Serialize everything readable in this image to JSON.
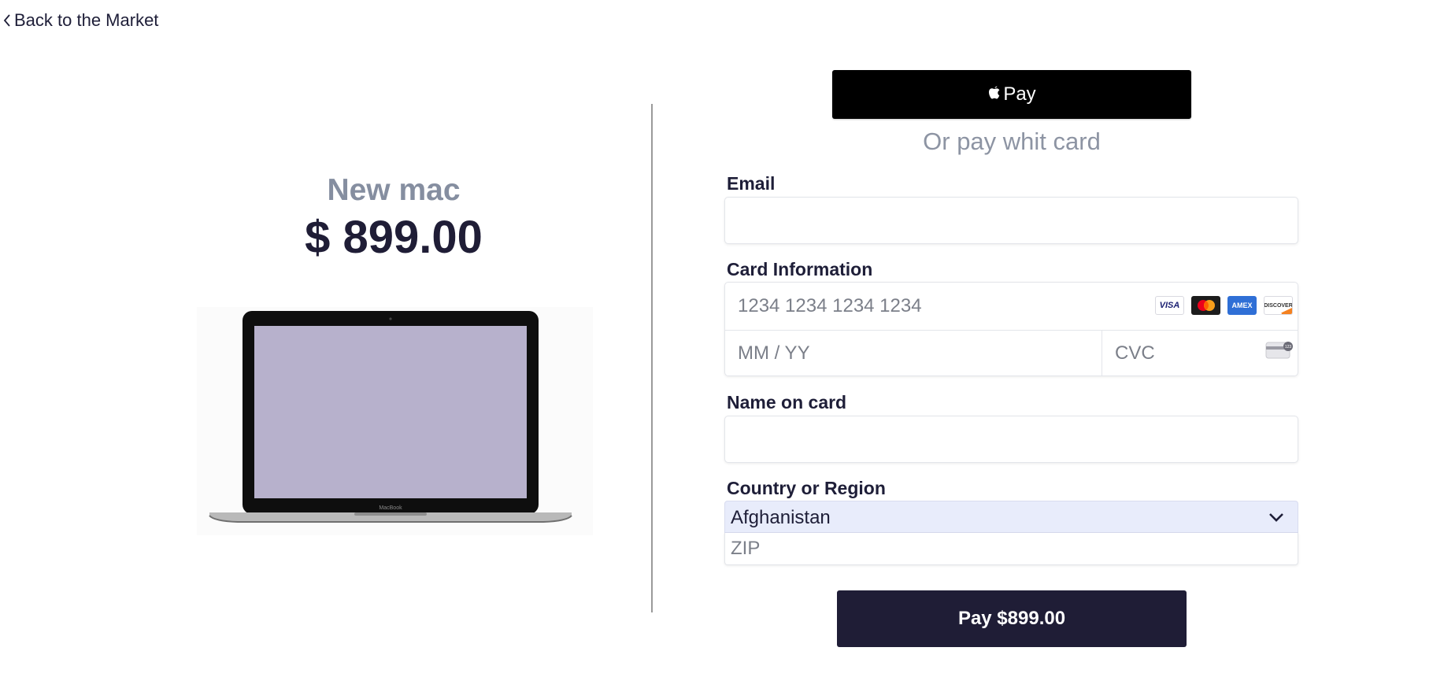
{
  "nav": {
    "back_label": "Back to the Market"
  },
  "product": {
    "name": "New mac",
    "price": "$ 899.00",
    "image_alt": "MacBook laptop",
    "laptop_brand": "MacBook"
  },
  "apple_pay": {
    "label": "Pay"
  },
  "divider_text": "Or pay whit card",
  "form": {
    "email": {
      "label": "Email",
      "value": "",
      "placeholder": ""
    },
    "card": {
      "label": "Card Information",
      "number_placeholder": "1234 1234 1234 1234",
      "expiry_placeholder": "MM / YY",
      "cvc_placeholder": "CVC",
      "brands": [
        "VISA",
        "Mastercard",
        "AMEX",
        "DISCOVER"
      ],
      "cvc_hint": "123"
    },
    "name": {
      "label": "Name on card",
      "value": ""
    },
    "country": {
      "label": "Country or Region",
      "selected": "Afghanistan"
    },
    "zip": {
      "placeholder": "ZIP"
    }
  },
  "pay_button": {
    "label": "Pay $899.00"
  },
  "colors": {
    "primary": "#1f1d36",
    "muted_text": "#858ea0",
    "select_bg": "#e8ecfb",
    "screen": "#b7b1cc"
  }
}
